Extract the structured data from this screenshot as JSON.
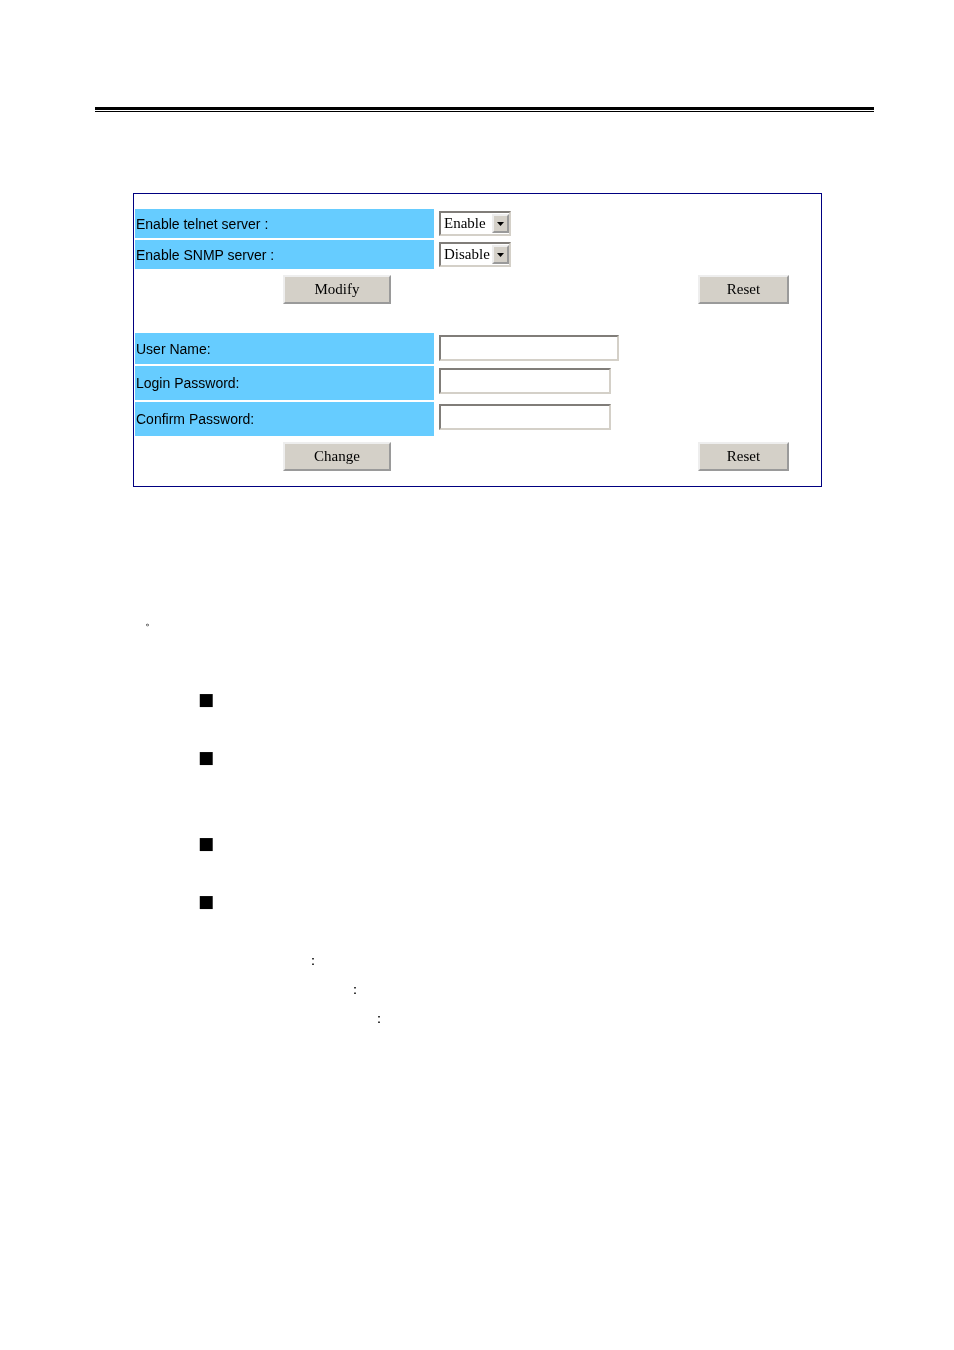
{
  "settings_form": {
    "fields": [
      {
        "label": "Enable telnet server :",
        "kind": "select",
        "value": "Enable"
      },
      {
        "label": "Enable SNMP server :",
        "kind": "select",
        "value": "Disable"
      }
    ],
    "buttons": [
      "Modify",
      "Reset"
    ]
  },
  "account_form": {
    "fields": [
      {
        "label": "User Name:",
        "kind": "text"
      },
      {
        "label": "Login Password:",
        "kind": "text"
      },
      {
        "label": "Confirm Password:",
        "kind": "text"
      }
    ],
    "buttons": [
      "Change",
      "Reset"
    ]
  },
  "body": {
    "period": "。",
    "bullets": [
      "■",
      "■",
      "■",
      "■"
    ],
    "colons": [
      "：",
      "：",
      "："
    ]
  }
}
